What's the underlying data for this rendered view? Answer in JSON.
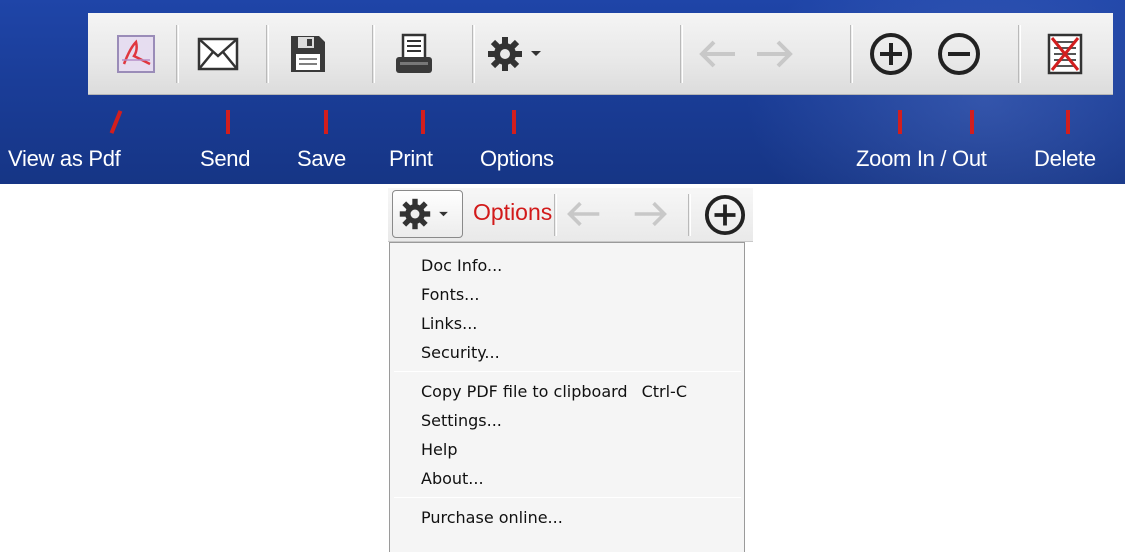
{
  "labels": {
    "view_as_pdf": "View as Pdf",
    "send": "Send",
    "save": "Save",
    "print": "Print",
    "options": "Options",
    "zoom": "Zoom In / Out",
    "delete": "Delete"
  },
  "callout": {
    "options_label": "Options"
  },
  "menu": {
    "items": [
      {
        "label": "Doc Info..."
      },
      {
        "label": "Fonts..."
      },
      {
        "label": "Links..."
      },
      {
        "label": "Security..."
      },
      {
        "label": "Copy PDF file to clipboard",
        "shortcut": "Ctrl-C"
      },
      {
        "label": "Settings..."
      },
      {
        "label": "Help"
      },
      {
        "label": "About..."
      },
      {
        "label": "Purchase online..."
      }
    ]
  },
  "icons": {
    "toolbar": [
      "pdf-icon",
      "envelope-icon",
      "floppy-disk-icon",
      "printer-icon",
      "gear-icon",
      "chevron-down-icon",
      "arrow-left-icon",
      "arrow-right-icon",
      "zoom-in-icon",
      "zoom-out-icon",
      "delete-icon"
    ]
  },
  "colors": {
    "banner_blue": "#1a3d98",
    "marker_red": "#d21e1e",
    "options_red": "#d21a1a",
    "disabled_arrow": "#c8c8c8"
  }
}
